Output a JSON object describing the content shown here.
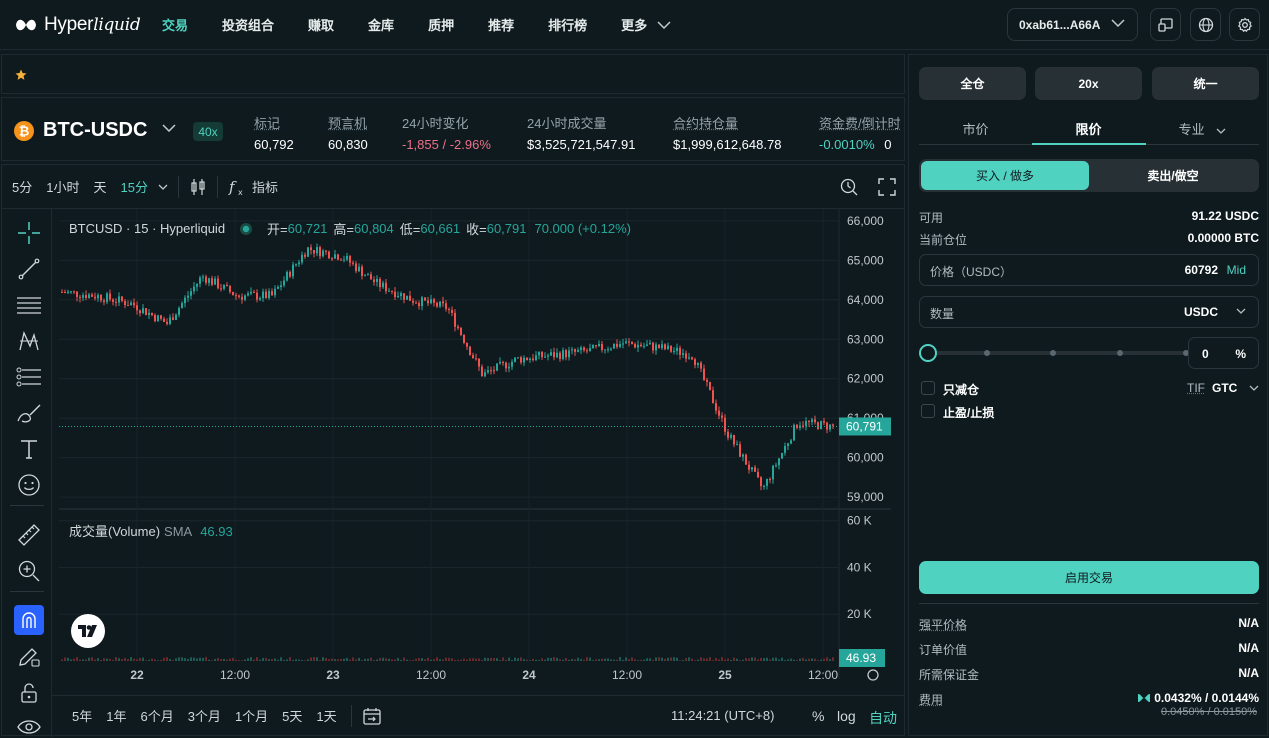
{
  "nav": {
    "brand_main": "Hyper",
    "brand_italic": "liquid",
    "items": [
      "交易",
      "投资组合",
      "赚取",
      "金库",
      "质押",
      "推荐",
      "排行榜",
      "更多"
    ],
    "wallet": "0xab61...A66A"
  },
  "ticker": {
    "pair": "BTC-USDC",
    "leverage_badge": "40x",
    "stats": [
      {
        "label": "标记",
        "value": "60,792"
      },
      {
        "label": "预言机",
        "value": "60,830"
      },
      {
        "label": "24小时变化",
        "value": "-1,855 / -2.96%"
      },
      {
        "label": "24小时成交量",
        "value": "$3,525,721,547.91"
      },
      {
        "label": "合约持仓量",
        "value": "$1,999,612,648.78"
      },
      {
        "label": "资金费/倒计时",
        "value": "-0.0010%",
        "value2": "0"
      }
    ]
  },
  "chart_toolbar": {
    "timeframes": [
      "5分",
      "1小时",
      "天",
      "15分"
    ],
    "active_timeframe": "15分",
    "indicators": "指标"
  },
  "chart": {
    "legend_symbol": "BTCUSD · 15 · Hyperliquid",
    "o_label": "开=",
    "o_value": "60,721",
    "h_label": "高=",
    "h_value": "60,804",
    "l_label": "低=",
    "l_value": "60,661",
    "c_label": "收=",
    "c_value": "60,791",
    "change": "70.000 (+0.12%)",
    "price_ticks": [
      "66,000",
      "65,000",
      "64,000",
      "63,000",
      "62,000",
      "61,000",
      "60,000",
      "59,000"
    ],
    "price_tag": "60,791",
    "volume_title": "成交量(Volume)",
    "volume_sma": "SMA",
    "volume_value": "46.93",
    "volume_ticks": [
      "60 K",
      "40 K",
      "20 K"
    ],
    "volume_tag": "46.93",
    "time_ticks": [
      "22",
      "12:00",
      "23",
      "12:00",
      "24",
      "12:00",
      "25",
      "12:00"
    ]
  },
  "chart_data": {
    "type": "line",
    "title": "BTCUSD · 15 · Hyperliquid",
    "xlabel": "",
    "ylabel": "",
    "x": [
      "21 20:00",
      "22 00:00",
      "22 04:00",
      "22 08:00",
      "22 12:00",
      "22 16:00",
      "22 20:00",
      "23 00:00",
      "23 04:00",
      "23 08:00",
      "23 12:00",
      "23 16:00",
      "23 20:00",
      "24 00:00",
      "24 04:00",
      "24 08:00",
      "24 12:00",
      "24 16:00",
      "24 20:00",
      "25 00:00",
      "25 04:00",
      "25 08:00",
      "25 11:15"
    ],
    "series": [
      {
        "values": [
          64200,
          64100,
          63900,
          63400,
          64600,
          64100,
          64100,
          65300,
          65100,
          64400,
          64000,
          63800,
          62100,
          62500,
          62600,
          62700,
          62900,
          62800,
          62600,
          60600,
          59200,
          60900,
          60791
        ]
      }
    ],
    "ylim": [
      58700,
      66300
    ],
    "volume_ylim": [
      0,
      65000
    ],
    "volume_last": 46.93
  },
  "ranges": [
    "5年",
    "1年",
    "6个月",
    "3个月",
    "1个月",
    "5天",
    "1天"
  ],
  "clock": "11:24:21 (UTC+8)",
  "axis_opts": [
    "%",
    "log",
    "自动"
  ],
  "order": {
    "margin_mode": "全仓",
    "leverage": "20x",
    "unified": "统一",
    "tabs": [
      "市价",
      "限价",
      "专业"
    ],
    "buy": "买入 / 做多",
    "sell": "卖出/做空",
    "available_label": "可用",
    "available_value": "91.22 USDC",
    "position_label": "当前仓位",
    "position_value": "0.00000 BTC",
    "price_label": "价格（USDC）",
    "price_value": "60792",
    "mid": "Mid",
    "qty_label": "数量",
    "qty_unit": "USDC",
    "pct_value": "0",
    "pct_sign": "%",
    "reduce_only": "只减仓",
    "tif_label": "TIF",
    "tif_value": "GTC",
    "tpsl": "止盈/止损",
    "enable": "启用交易",
    "liq_label": "强平价格",
    "liq_value": "N/A",
    "order_value_label": "订单价值",
    "order_value": "N/A",
    "margin_label": "所需保证金",
    "margin_value": "N/A",
    "fee_label": "费用",
    "fee_value": "0.0432% / 0.0144%",
    "fee_old": "0.0450% / 0.0150%"
  },
  "colors": {
    "accent": "#50d2c1",
    "up": "#26a69a",
    "down": "#ef5350",
    "negative_text": "#ed7088"
  }
}
